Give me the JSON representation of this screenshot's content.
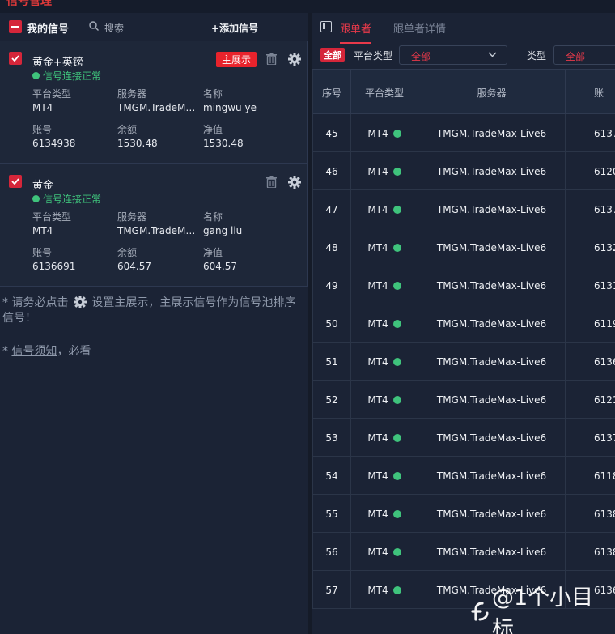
{
  "app": {
    "top_title": "信号管理"
  },
  "left": {
    "header": {
      "title": "我的信号",
      "search_label": "搜索",
      "add_label": "+添加信号"
    },
    "cards": [
      {
        "name": "黄金+英镑",
        "status": "信号连接正常",
        "main_label": "主展示",
        "platform_label": "平台类型",
        "platform": "MT4",
        "server_label": "服务器",
        "server": "TMGM.TradeMa...",
        "name_label": "名称",
        "account_name": "mingwu ye",
        "account_label": "账号",
        "account": "6134938",
        "balance_label": "余额",
        "balance": "1530.48",
        "equity_label": "净值",
        "equity": "1530.48"
      },
      {
        "name": "黄金",
        "status": "信号连接正常",
        "platform_label": "平台类型",
        "platform": "MT4",
        "server_label": "服务器",
        "server": "TMGM.TradeMa...",
        "name_label": "名称",
        "account_name": "gang liu",
        "account_label": "账号",
        "account": "6136691",
        "balance_label": "余额",
        "balance": "604.57",
        "equity_label": "净值",
        "equity": "604.57"
      }
    ],
    "note1_prefix": "* 请务必点击",
    "note1_suffix": "设置主展示，主展示信号作为信号池排序信号！",
    "note2_prefix": "* ",
    "note2_link": "信号须知",
    "note2_suffix": "，必看"
  },
  "right": {
    "tabs": [
      "跟单者",
      "跟单者详情"
    ],
    "filters": {
      "all_badge": "全部",
      "platform_label": "平台类型",
      "platform_value": "全部",
      "type_label": "类型",
      "type_value": "全部"
    },
    "columns": [
      "序号",
      "平台类型",
      "服务器",
      "账"
    ],
    "rows": [
      {
        "no": "45",
        "platform": "MT4",
        "server": "TMGM.TradeMax-Live6",
        "account": "6137"
      },
      {
        "no": "46",
        "platform": "MT4",
        "server": "TMGM.TradeMax-Live6",
        "account": "6120"
      },
      {
        "no": "47",
        "platform": "MT4",
        "server": "TMGM.TradeMax-Live6",
        "account": "6137"
      },
      {
        "no": "48",
        "platform": "MT4",
        "server": "TMGM.TradeMax-Live6",
        "account": "6132"
      },
      {
        "no": "49",
        "platform": "MT4",
        "server": "TMGM.TradeMax-Live6",
        "account": "6131"
      },
      {
        "no": "50",
        "platform": "MT4",
        "server": "TMGM.TradeMax-Live6",
        "account": "6119"
      },
      {
        "no": "51",
        "platform": "MT4",
        "server": "TMGM.TradeMax-Live6",
        "account": "6136"
      },
      {
        "no": "52",
        "platform": "MT4",
        "server": "TMGM.TradeMax-Live6",
        "account": "6121"
      },
      {
        "no": "53",
        "platform": "MT4",
        "server": "TMGM.TradeMax-Live6",
        "account": "6137"
      },
      {
        "no": "54",
        "platform": "MT4",
        "server": "TMGM.TradeMax-Live6",
        "account": "6118"
      },
      {
        "no": "55",
        "platform": "MT4",
        "server": "TMGM.TradeMax-Live6",
        "account": "6138"
      },
      {
        "no": "56",
        "platform": "MT4",
        "server": "TMGM.TradeMax-Live6",
        "account": "6138"
      },
      {
        "no": "57",
        "platform": "MT4",
        "server": "TMGM.TradeMax-Live6",
        "account": "6136"
      }
    ]
  },
  "watermark": "@1个小目标",
  "colors": {
    "accent_red": "#d5263a",
    "status_green": "#3fc37c",
    "bg": "#1b2335"
  },
  "icons": [
    "search-icon",
    "trash-icon",
    "gear-icon",
    "checkbox-icon",
    "panel-toggle-icon",
    "chevron-down-icon"
  ]
}
